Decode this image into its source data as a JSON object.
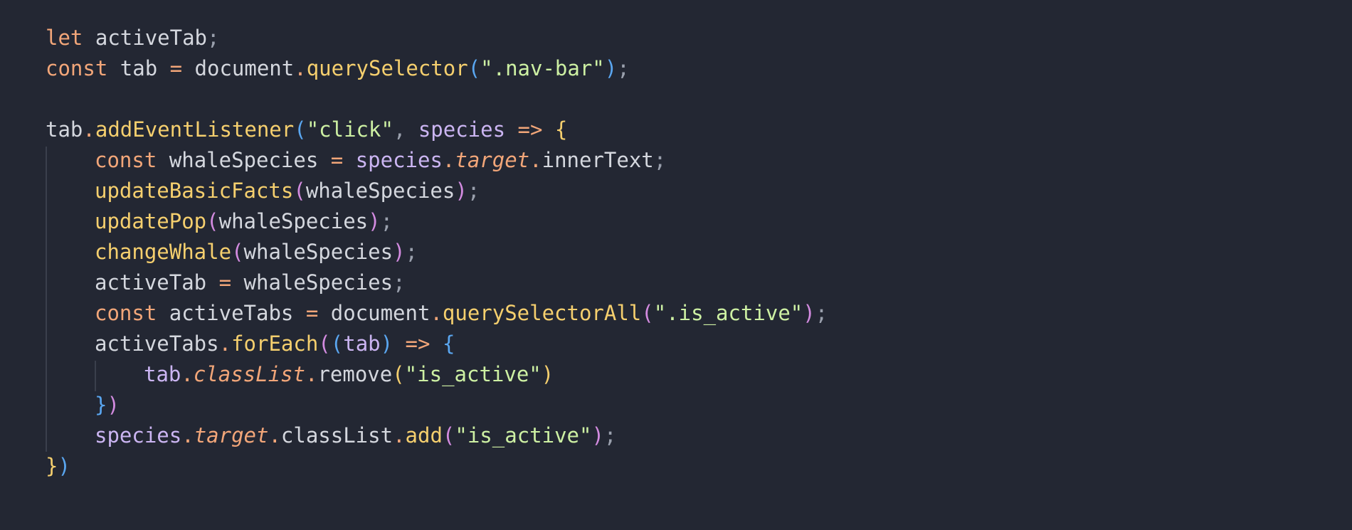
{
  "code_lines": [
    [
      {
        "t": "let",
        "c": "kw"
      },
      {
        "t": " ",
        "c": "id"
      },
      {
        "t": "activeTab",
        "c": "id"
      },
      {
        "t": ";",
        "c": "punct"
      }
    ],
    [
      {
        "t": "const",
        "c": "kw"
      },
      {
        "t": " tab ",
        "c": "id"
      },
      {
        "t": "=",
        "c": "op"
      },
      {
        "t": " document",
        "c": "id"
      },
      {
        "t": ".",
        "c": "op"
      },
      {
        "t": "querySelector",
        "c": "fn"
      },
      {
        "t": "(",
        "c": "p-blue"
      },
      {
        "t": "\".nav-bar\"",
        "c": "str"
      },
      {
        "t": ")",
        "c": "p-blue"
      },
      {
        "t": ";",
        "c": "punct"
      }
    ],
    [],
    [
      {
        "t": "tab",
        "c": "id"
      },
      {
        "t": ".",
        "c": "op"
      },
      {
        "t": "addEventListener",
        "c": "fn"
      },
      {
        "t": "(",
        "c": "p-blue"
      },
      {
        "t": "\"click\"",
        "c": "str"
      },
      {
        "t": ", ",
        "c": "punct"
      },
      {
        "t": "species",
        "c": "param"
      },
      {
        "t": " => ",
        "c": "op"
      },
      {
        "t": "{",
        "c": "p-yellow"
      }
    ],
    [
      {
        "t": "const",
        "c": "kw"
      },
      {
        "t": " whaleSpecies ",
        "c": "id"
      },
      {
        "t": "=",
        "c": "op"
      },
      {
        "t": " ",
        "c": "id"
      },
      {
        "t": "species",
        "c": "param"
      },
      {
        "t": ".",
        "c": "op"
      },
      {
        "t": "target",
        "c": "prop"
      },
      {
        "t": ".",
        "c": "op"
      },
      {
        "t": "innerText",
        "c": "id"
      },
      {
        "t": ";",
        "c": "punct"
      }
    ],
    [
      {
        "t": "updateBasicFacts",
        "c": "fn"
      },
      {
        "t": "(",
        "c": "par"
      },
      {
        "t": "whaleSpecies",
        "c": "id"
      },
      {
        "t": ")",
        "c": "par"
      },
      {
        "t": ";",
        "c": "punct"
      }
    ],
    [
      {
        "t": "updatePop",
        "c": "fn"
      },
      {
        "t": "(",
        "c": "par"
      },
      {
        "t": "whaleSpecies",
        "c": "id"
      },
      {
        "t": ")",
        "c": "par"
      },
      {
        "t": ";",
        "c": "punct"
      }
    ],
    [
      {
        "t": "changeWhale",
        "c": "fn"
      },
      {
        "t": "(",
        "c": "par"
      },
      {
        "t": "whaleSpecies",
        "c": "id"
      },
      {
        "t": ")",
        "c": "par"
      },
      {
        "t": ";",
        "c": "punct"
      }
    ],
    [
      {
        "t": "activeTab ",
        "c": "id"
      },
      {
        "t": "=",
        "c": "op"
      },
      {
        "t": " whaleSpecies",
        "c": "id"
      },
      {
        "t": ";",
        "c": "punct"
      }
    ],
    [
      {
        "t": "const",
        "c": "kw"
      },
      {
        "t": " activeTabs ",
        "c": "id"
      },
      {
        "t": "=",
        "c": "op"
      },
      {
        "t": " document",
        "c": "id"
      },
      {
        "t": ".",
        "c": "op"
      },
      {
        "t": "querySelectorAll",
        "c": "fn"
      },
      {
        "t": "(",
        "c": "par"
      },
      {
        "t": "\".is_active\"",
        "c": "str"
      },
      {
        "t": ")",
        "c": "par"
      },
      {
        "t": ";",
        "c": "punct"
      }
    ],
    [
      {
        "t": "activeTabs",
        "c": "id"
      },
      {
        "t": ".",
        "c": "op"
      },
      {
        "t": "forEach",
        "c": "fn"
      },
      {
        "t": "(",
        "c": "par"
      },
      {
        "t": "(",
        "c": "p-blue"
      },
      {
        "t": "tab",
        "c": "param"
      },
      {
        "t": ")",
        "c": "p-blue"
      },
      {
        "t": " => ",
        "c": "op"
      },
      {
        "t": "{",
        "c": "p-blue"
      }
    ],
    [
      {
        "t": "tab",
        "c": "param"
      },
      {
        "t": ".",
        "c": "op"
      },
      {
        "t": "classList",
        "c": "prop"
      },
      {
        "t": ".",
        "c": "op"
      },
      {
        "t": "remove",
        "c": "id"
      },
      {
        "t": "(",
        "c": "p-yellow"
      },
      {
        "t": "\"is_active\"",
        "c": "str"
      },
      {
        "t": ")",
        "c": "p-yellow"
      }
    ],
    [
      {
        "t": "}",
        "c": "p-blue"
      },
      {
        "t": ")",
        "c": "par"
      }
    ],
    [
      {
        "t": "species",
        "c": "param"
      },
      {
        "t": ".",
        "c": "op"
      },
      {
        "t": "target",
        "c": "prop"
      },
      {
        "t": ".",
        "c": "op"
      },
      {
        "t": "classList",
        "c": "id"
      },
      {
        "t": ".",
        "c": "op"
      },
      {
        "t": "add",
        "c": "fn"
      },
      {
        "t": "(",
        "c": "par"
      },
      {
        "t": "\"is_active\"",
        "c": "str"
      },
      {
        "t": ")",
        "c": "par"
      },
      {
        "t": ";",
        "c": "punct"
      }
    ],
    [
      {
        "t": "}",
        "c": "p-yellow"
      },
      {
        "t": ")",
        "c": "p-blue"
      }
    ]
  ],
  "colors": {
    "background": "#232733",
    "keyword": "#f2a679",
    "function": "#f5cf6e",
    "string": "#cdf0a3",
    "parameter": "#cbb5f2",
    "paren_blue": "#5aa6f0",
    "paren_purple": "#d38be0"
  }
}
